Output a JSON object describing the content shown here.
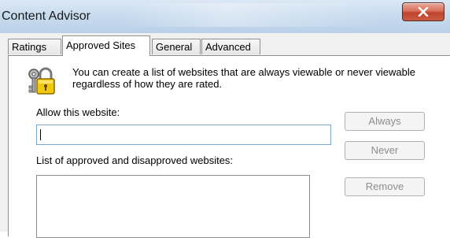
{
  "window": {
    "title": "Content Advisor",
    "close_icon": "close-icon"
  },
  "tabs": [
    {
      "label": "Ratings",
      "active": false
    },
    {
      "label": "Approved Sites",
      "active": true
    },
    {
      "label": "General",
      "active": false
    },
    {
      "label": "Advanced",
      "active": false
    }
  ],
  "approved_sites": {
    "icon": "lock-keys-icon",
    "description": "You can create a list of websites that are always viewable or never viewable regardless of how they are rated.",
    "allow_label": "Allow this website:",
    "allow_value": "",
    "list_label": "List of approved and disapproved websites:",
    "buttons": {
      "always": "Always",
      "never": "Never",
      "remove": "Remove"
    }
  },
  "colors": {
    "close_button": "#c7513b",
    "disabled_text": "#8d8d8d",
    "input_border": "#7fa5c8"
  }
}
